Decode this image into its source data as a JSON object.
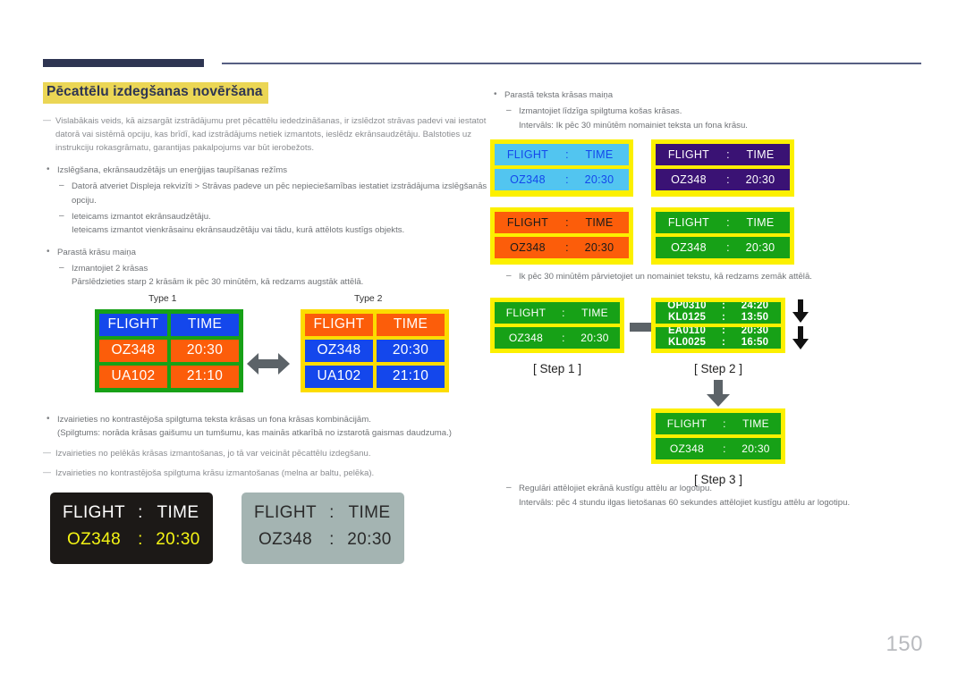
{
  "page": {
    "number": "150",
    "title": "Pēcattēlu izdegšanas novēršana"
  },
  "left_column": {
    "intro_dash": "Vislabākais veids, kā aizsargāt izstrādājumu pret pēcattēlu iededzināšanas, ir izslēdzot strāvas padevi vai iestatot datorā vai sistēmā opciju, kas brīdī, kad izstrādājums netiek izmantots, ieslēdz ekrānsaudzētāju. Balstoties uz instrukciju rokasgrāmatu, garantijas pakalpojums var būt ierobežots.",
    "bullet1": "Izslēgšana, ekrānsaudzētājs un enerģijas taupīšanas režīms",
    "bullet1_sub1": "Datorā atveriet Displeja rekvizīti > Strāvas padeve un pēc nepieciešamības iestatiet izstrādājuma izslēgšanās opciju.",
    "bullet1_sub2": "Ieteicams izmantot ekrānsaudzētāju.",
    "bullet1_sub2_cont": "Ieteicams izmantot vienkrāsainu ekrānsaudzētāju vai tādu, kurā attēlots kustīgs objekts.",
    "bullet2": "Parastā krāsu maiņa",
    "bullet2_sub1": "Izmantojiet 2 krāsas",
    "bullet2_sub1_cont": "Pārslēdzieties starp 2 krāsām ik pēc 30 minūtēm, kā redzams augstāk attēlā.",
    "bullet3": "Izvairieties no kontrastējoša spilgtuma teksta krāsas un fona krāsas kombinācijām.",
    "bullet3_cont": "(Spilgtums: norāda krāsas gaišumu un tumšumu, kas mainās atkarībā no izstarotā gaismas daudzuma.)",
    "dash2": "Izvairieties no pelēkās krāsas izmantošanas, jo tā var veicināt pēcattēlu izdegšanu.",
    "dash3": "Izvairieties no kontrastējoša spilgtuma krāsu izmantošanas (melna ar baltu, pelēka)."
  },
  "type_compare": {
    "type1_label": "Type 1",
    "type2_label": "Type 2",
    "headers": [
      "FLIGHT",
      "TIME"
    ],
    "rows": [
      [
        "OZ348",
        "20:30"
      ],
      [
        "UA102",
        "21:10"
      ]
    ],
    "type1_colors": {
      "border": "#17a117",
      "header": "#1447ec",
      "data": "#fc5d0a"
    },
    "type2_colors": {
      "border": "#fcdc00",
      "header": "#fc5d0a",
      "data": "#1447ec"
    }
  },
  "mono_boards": {
    "black": {
      "header": {
        "left": "FLIGHT",
        "sep": ":",
        "right": "TIME"
      },
      "data": {
        "left": "OZ348",
        "sep": ":",
        "right": "20:30"
      },
      "bg": "#1c1917",
      "header_color": "#ffffff",
      "data_color": "#f5f514"
    },
    "gray": {
      "header": {
        "left": "FLIGHT",
        "sep": ":",
        "right": "TIME"
      },
      "data": {
        "left": "OZ348",
        "sep": ":",
        "right": "20:30"
      },
      "bg": "#a4b4b2",
      "text_color": "#2a2a2a"
    }
  },
  "right_column": {
    "bullet1": "Parastā teksta krāsas maiņa",
    "bullet1_sub1": "Izmantojiet līdzīga spilgtuma košas krāsas.",
    "bullet1_sub1_cont": "Intervāls: Ik pēc 30 minūtēm nomainiet teksta un fona krāsu.",
    "sub_move": "Ik pēc 30 minūtēm pārvietojiet un nomainiet tekstu, kā redzams zemāk attēlā.",
    "final_sub": "Regulāri attēlojiet ekrānā kustīgu attēlu ar logotipu.",
    "final_cont": "Intervāls: pēc 4 stundu ilgas lietošanas 60 sekundes attēlojiet kustīgu attēlu ar logotipu."
  },
  "color_grid": {
    "frame_color": "#fcf000",
    "boards": [
      {
        "name": "cyan",
        "fill": "#52c5f0",
        "text": "#1447ec",
        "header": {
          "left": "FLIGHT",
          "sep": ":",
          "right": "TIME"
        },
        "data": {
          "left": "OZ348",
          "sep": ":",
          "right": "20:30"
        }
      },
      {
        "name": "purple",
        "fill": "#3a1274",
        "text": "#ffffff",
        "header": {
          "left": "FLIGHT",
          "sep": ":",
          "right": "TIME"
        },
        "data": {
          "left": "OZ348",
          "sep": ":",
          "right": "20:30"
        }
      },
      {
        "name": "orange",
        "fill": "#fc5d0a",
        "text": "#1a1a1a",
        "header": {
          "left": "FLIGHT",
          "sep": ":",
          "right": "TIME"
        },
        "data": {
          "left": "OZ348",
          "sep": ":",
          "right": "20:30"
        }
      },
      {
        "name": "green",
        "fill": "#17a117",
        "text": "#ffffff",
        "header": {
          "left": "FLIGHT",
          "sep": ":",
          "right": "TIME"
        },
        "data": {
          "left": "OZ348",
          "sep": ":",
          "right": "20:30"
        }
      }
    ]
  },
  "steps": {
    "step1": {
      "label": "[ Step 1 ]",
      "header": {
        "left": "FLIGHT",
        "sep": ":",
        "right": "TIME"
      },
      "data": {
        "left": "OZ348",
        "sep": ":",
        "right": "20:30"
      }
    },
    "step2": {
      "label": "[ Step 2 ]",
      "row1_top": {
        "left": "OP0310",
        "sep": ":",
        "right": "24:20"
      },
      "row1_bottom": {
        "left": "KL0125",
        "sep": ":",
        "right": "13:50"
      },
      "row2_top": {
        "left": "EA0110",
        "sep": ":",
        "right": "20:30"
      },
      "row2_bottom": {
        "left": "KL0025",
        "sep": ":",
        "right": "16:50"
      }
    },
    "step3": {
      "label": "[ Step 3 ]",
      "header": {
        "left": "FLIGHT",
        "sep": ":",
        "right": "TIME"
      },
      "data": {
        "left": "OZ348",
        "sep": ":",
        "right": "20:30"
      }
    }
  }
}
